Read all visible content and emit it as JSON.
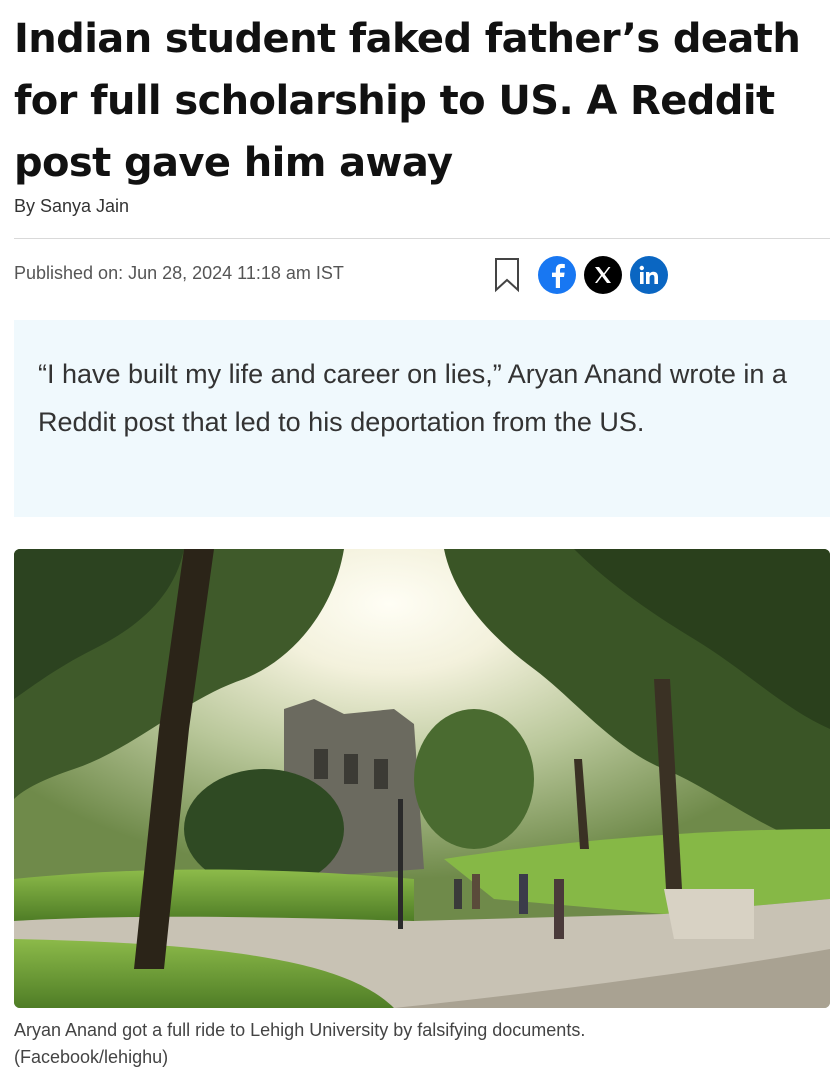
{
  "article": {
    "headline": "Indian student faked father’s death for full scholarship to US. A Reddit post gave him away",
    "byline": "By Sanya Jain",
    "published": "Published on: Jun 28, 2024 11:18 am IST",
    "summary": "“I have built my life and career on lies,” Aryan Anand wrote in a Reddit post that led to his deportation from the US.",
    "caption_line1": "Aryan Anand got a full ride to Lehigh University by falsifying documents.",
    "caption_line2": "(Facebook/lehighu)"
  },
  "share": {
    "icons": [
      "bookmark-icon",
      "facebook-icon",
      "x-icon",
      "linkedin-icon"
    ],
    "facebook_color": "#1877f2",
    "x_color": "#000000",
    "linkedin_color": "#0a66c2"
  },
  "colors": {
    "summary_background": "#f0f9fd",
    "text": "#111111"
  }
}
